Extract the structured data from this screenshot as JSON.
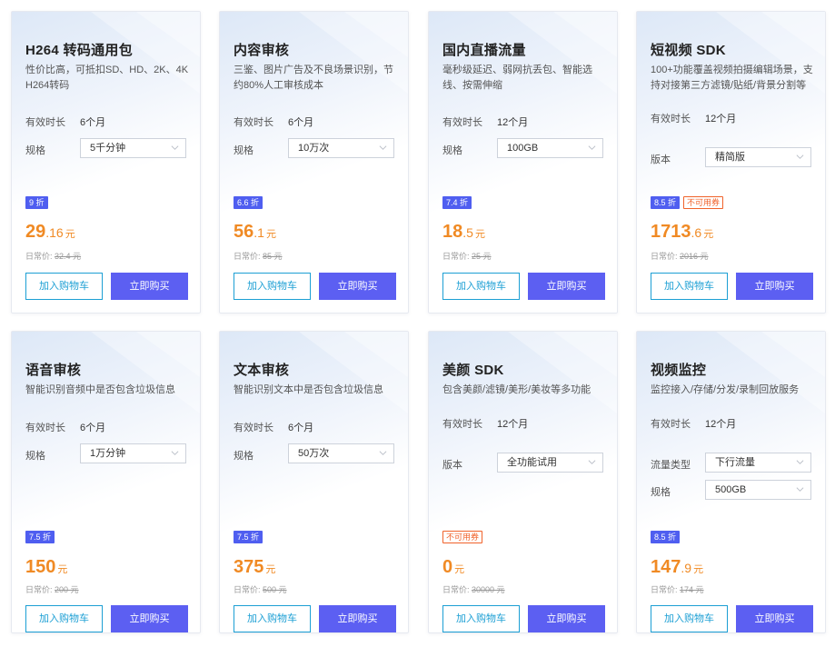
{
  "labels": {
    "duration": "有效时长",
    "spec": "规格",
    "version": "版本",
    "traffic_type": "流量类型",
    "orig_prefix": "日常价:",
    "unit": "元",
    "add_to_cart": "加入购物车",
    "buy_now": "立即购买",
    "no_coupon": "不可用券"
  },
  "colors": {
    "accent": "#5c5ff2",
    "price": "#f08a24",
    "outline": "#1c9fd4",
    "warn": "#f0622a"
  },
  "cards": [
    {
      "title": "H264 转码通用包",
      "desc": "性价比高，可抵扣SD、HD、2K、4K H264转码",
      "duration": "6个月",
      "spec": "5千分钟",
      "discount": "9 折",
      "price_int": "29",
      "price_dec": ".16",
      "orig": "32.4 元"
    },
    {
      "title": "内容审核",
      "desc": "三鉴、图片广告及不良场景识别，节约80%人工审核成本",
      "duration": "6个月",
      "spec": "10万次",
      "discount": "6.6 折",
      "price_int": "56",
      "price_dec": ".1",
      "orig": "85 元"
    },
    {
      "title": "国内直播流量",
      "desc": "毫秒级延迟、弱网抗丢包、智能选线、按需伸缩",
      "duration": "12个月",
      "spec": "100GB",
      "discount": "7.4 折",
      "price_int": "18",
      "price_dec": ".5",
      "orig": "25 元"
    },
    {
      "title": "短视频 SDK",
      "desc": "100+功能覆盖视频拍摄编辑场景，支持对接第三方滤镜/贴纸/背景分割等",
      "duration": "12个月",
      "version": "精简版",
      "discount": "8.5 折",
      "price_int": "1713",
      "price_dec": ".6",
      "orig": "2016 元"
    },
    {
      "title": "语音审核",
      "desc": "智能识别音频中是否包含垃圾信息",
      "duration": "6个月",
      "spec": "1万分钟",
      "discount": "7.5 折",
      "price_int": "150",
      "price_dec": "",
      "orig": "200 元"
    },
    {
      "title": "文本审核",
      "desc": "智能识别文本中是否包含垃圾信息",
      "duration": "6个月",
      "spec": "50万次",
      "discount": "7.5 折",
      "price_int": "375",
      "price_dec": "",
      "orig": "500 元"
    },
    {
      "title": "美颜 SDK",
      "desc": "包含美颜/滤镜/美形/美妆等多功能",
      "duration": "12个月",
      "version": "全功能试用",
      "price_int": "0",
      "price_dec": "",
      "orig": "30000 元"
    },
    {
      "title": "视频监控",
      "desc": "监控接入/存储/分发/录制回放服务",
      "duration": "12个月",
      "traffic_type": "下行流量",
      "spec": "500GB",
      "discount": "8.5 折",
      "price_int": "147",
      "price_dec": ".9",
      "orig": "174 元"
    }
  ]
}
